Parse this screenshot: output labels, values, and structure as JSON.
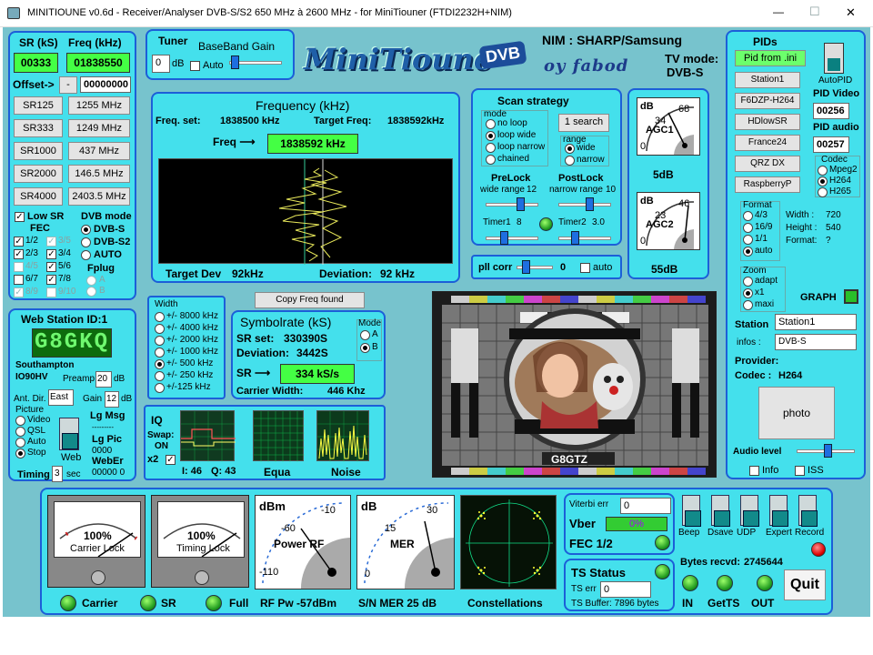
{
  "window": {
    "title": "MINITIOUNE v0.6d - Receiver/Analyser DVB-S/S2 650 MHz à 2600 MHz - for MiniTiouner (FTDI2232H+NIM)",
    "minimize": "—",
    "maximize": "☐",
    "close": "✕"
  },
  "sr": {
    "sr_label": "SR (kS)",
    "freq_label": "Freq (kHz)",
    "sr_value": "00333",
    "freq_value": "01838550",
    "offset_label": "Offset->",
    "offset_sign": "-",
    "offset_value": "00000000",
    "presets": [
      {
        "sr": "SR125",
        "freq": "1255 MHz"
      },
      {
        "sr": "SR333",
        "freq": "1249 MHz"
      },
      {
        "sr": "SR1000",
        "freq": "437 MHz"
      },
      {
        "sr": "SR2000",
        "freq": "146.5 MHz"
      },
      {
        "sr": "SR4000",
        "freq": "2403.5 MHz"
      }
    ],
    "low_sr": "Low SR",
    "fec_label": "FEC",
    "dvb_mode_label": "DVB mode",
    "fec": [
      {
        "label": "1/2",
        "checked": true,
        "enabled": true
      },
      {
        "label": "3/5",
        "checked": true,
        "enabled": false
      },
      {
        "label": "2/3",
        "checked": true,
        "enabled": true
      },
      {
        "label": "3/4",
        "checked": true,
        "enabled": true
      },
      {
        "label": "4/5",
        "checked": false,
        "enabled": false
      },
      {
        "label": "5/6",
        "checked": true,
        "enabled": true
      },
      {
        "label": "6/7",
        "checked": false,
        "enabled": true
      },
      {
        "label": "7/8",
        "checked": true,
        "enabled": true
      },
      {
        "label": "8/9",
        "checked": true,
        "enabled": false
      },
      {
        "label": "9/10",
        "checked": false,
        "enabled": false
      }
    ],
    "dvb_modes": [
      {
        "label": "DVB-S",
        "on": true
      },
      {
        "label": "DVB-S2",
        "on": false
      },
      {
        "label": "AUTO",
        "on": false
      }
    ],
    "fplug_label": "Fplug",
    "fplug": [
      {
        "label": "A"
      },
      {
        "label": "B"
      }
    ]
  },
  "tuner": {
    "title": "Tuner",
    "bb_label": "BaseBand Gain",
    "value": "0",
    "unit": "dB",
    "auto": "Auto"
  },
  "logo": {
    "text": "MiniTioune",
    "badge": "DVB",
    "sig": "oy fabod"
  },
  "nim": {
    "title": "NIM : SHARP/Samsung",
    "tv_mode_label": "TV mode:",
    "tv_mode": "DVB-S"
  },
  "frequency": {
    "title": "Frequency (kHz)",
    "freq_set_label": "Freq. set:",
    "freq_set": "1838500 kHz",
    "target_label": "Target Freq:",
    "target": "1838592kHz",
    "freq_arrow": "Freq ⟶",
    "freq_value": "1838592 kHz",
    "target_dev_label": "Target Dev",
    "target_dev": "92kHz",
    "deviation_label": "Deviation:",
    "deviation": "92 kHz"
  },
  "scan": {
    "title": "Scan strategy",
    "mode_label": "mode",
    "modes": [
      {
        "label": "no loop",
        "on": false
      },
      {
        "label": "loop wide",
        "on": true
      },
      {
        "label": "loop narrow",
        "on": false
      },
      {
        "label": "chained",
        "on": false
      }
    ],
    "search_button": "1 search",
    "range_label": "range",
    "ranges": [
      {
        "label": "wide",
        "on": true
      },
      {
        "label": "narrow",
        "on": false
      }
    ],
    "prelock": "PreLock",
    "prelock_sub": "wide range",
    "prelock_val": "12",
    "postlock": "PostLock",
    "postlock_sub": "narrow range",
    "postlock_val": "10",
    "timer1": "Timer1",
    "timer1_val": "8",
    "timer2": "Timer2",
    "timer2_val": "3.0"
  },
  "pll": {
    "label": "pll corr",
    "value": "0",
    "auto": "auto"
  },
  "agc": {
    "agc1_unit": "dB",
    "agc1_a": "34",
    "agc1_b": "68",
    "agc1_zero": "0",
    "agc1_name": "AGC1",
    "agc1_value": "5dB",
    "agc2_unit": "dB",
    "agc2_a": "23",
    "agc2_b": "46",
    "agc2_zero": "0",
    "agc2_name": "AGC2",
    "agc2_value": "55dB"
  },
  "pids": {
    "title": "PIDs",
    "pid_from_ini": "Pid from .ini",
    "autopid": "AutoPID",
    "stations": [
      "Station1",
      "F6DZP-H264",
      "HDlowSR",
      "France24",
      "QRZ DX",
      "RaspberryP"
    ],
    "pid_video_label": "PID Video",
    "pid_video": "00256",
    "pid_audio_label": "PID audio",
    "pid_audio": "00257",
    "codec_label": "Codec",
    "codecs": [
      {
        "label": "Mpeg2",
        "on": false
      },
      {
        "label": "H264",
        "on": true
      },
      {
        "label": "H265",
        "on": false
      }
    ],
    "format_label": "Format",
    "formats": [
      {
        "label": "4/3",
        "on": false
      },
      {
        "label": "16/9",
        "on": false
      },
      {
        "label": "1/1",
        "on": false
      },
      {
        "label": "auto",
        "on": true
      }
    ],
    "width_label": "Width :",
    "width": "720",
    "height_label": "Height :",
    "height": "540",
    "format_info_label": "Format:",
    "format_info": "?",
    "zoom_label": "Zoom",
    "zooms": [
      {
        "label": "adapt",
        "on": false
      },
      {
        "label": "x1",
        "on": true
      },
      {
        "label": "maxi",
        "on": false
      }
    ],
    "graph_label": "GRAPH",
    "station_label": "Station",
    "station_value": "Station1",
    "infos_label": "infos :",
    "infos_value": "DVB-S",
    "provider_label": "Provider:",
    "codec_info_label": "Codec :",
    "codec_info": "H264",
    "photo": "photo",
    "audio_label": "Audio level",
    "info": "Info",
    "iss": "ISS"
  },
  "web": {
    "title": "Web Station ID:1",
    "callsign": "G8GKQ",
    "location": "Southampton",
    "locator": "IO90HV",
    "preamp_label": "Preamp",
    "preamp": "20",
    "preamp_unit": "dB",
    "ant_label": "Ant. Dir.",
    "ant": "East",
    "gain_label": "Gain",
    "gain": "12",
    "gain_unit": "dB",
    "picture_label": "Picture",
    "pictures": [
      {
        "label": "Video",
        "on": false
      },
      {
        "label": "QSL",
        "on": false
      },
      {
        "label": "Auto",
        "on": false
      },
      {
        "label": "Stop",
        "on": true
      }
    ],
    "web_label": "Web",
    "lg_msg": "Lg Msg",
    "lg_msg_val": "---------",
    "lg_pic": "Lg Pic",
    "lg_pic_val": "0000",
    "weber": "WebEr",
    "weber_val": "00000 0",
    "timing_label": "Timing",
    "timing": "3",
    "timing_unit": "sec"
  },
  "width_panel": {
    "title": "Width",
    "options": [
      {
        "label": "+/- 8000 kHz",
        "on": false
      },
      {
        "label": "+/- 4000 kHz",
        "on": false
      },
      {
        "label": "+/- 2000 kHz",
        "on": false
      },
      {
        "label": "+/- 1000 kHz",
        "on": false
      },
      {
        "label": "+/- 500 kHz",
        "on": true
      },
      {
        "label": "+/- 250 kHz",
        "on": false
      },
      {
        "label": "+/-125 kHz",
        "on": false
      }
    ]
  },
  "copy_freq": "Copy Freq found",
  "symbol": {
    "title": "Symbolrate (kS)",
    "sr_set_label": "SR set:",
    "sr_set": "330390S",
    "deviation_label": "Deviation:",
    "deviation": "3442S",
    "sr_arrow": "SR ⟶",
    "sr_value": "334 kS/s",
    "carrier_label": "Carrier Width:",
    "carrier": "446 Khz",
    "mode_label": "Mode",
    "modes": [
      {
        "label": "A",
        "on": false
      },
      {
        "label": "B",
        "on": true
      }
    ]
  },
  "iq": {
    "title": "IQ",
    "swap": "Swap:",
    "swap_val": "ON",
    "x2": "x2",
    "i_label": "I: 46",
    "q_label": "Q: 43",
    "equa": "Equa",
    "noise": "Noise"
  },
  "testcard": {
    "caption": "G8GTZ"
  },
  "bottom": {
    "carrier_pct": "100%",
    "carrier_lock": "Carrier Lock",
    "timing_pct": "100%",
    "timing_lock": "Timing Lock",
    "power_unit": "dBm",
    "power_a": "-60",
    "power_b": "-10",
    "power_name": "Power RF",
    "power_min": "-110",
    "mer_unit": "dB",
    "mer_a": "15",
    "mer_b": "30",
    "mer_name": "MER",
    "mer_min": "0",
    "carrier": "Carrier",
    "sr": "SR",
    "full": "Full",
    "rf_pw": "RF Pw -57dBm",
    "sn_mer": "S/N MER  25 dB",
    "constellations": "Constellations",
    "viterbi_label": "Viterbi err",
    "viterbi": "0",
    "vber_label": "Vber",
    "vber": "0%",
    "fec": "FEC 1/2",
    "ts_status": "TS Status",
    "ts_err_label": "TS err",
    "ts_err": "0",
    "ts_buffer": "TS Buffer: 7896 bytes",
    "toggles": [
      "Beep",
      "Dsave",
      "UDP",
      "Expert",
      "Record"
    ],
    "bytes_label": "Bytes recvd:",
    "bytes": "2745644",
    "in": "IN",
    "getts": "GetTS",
    "out": "OUT",
    "quit": "Quit"
  }
}
